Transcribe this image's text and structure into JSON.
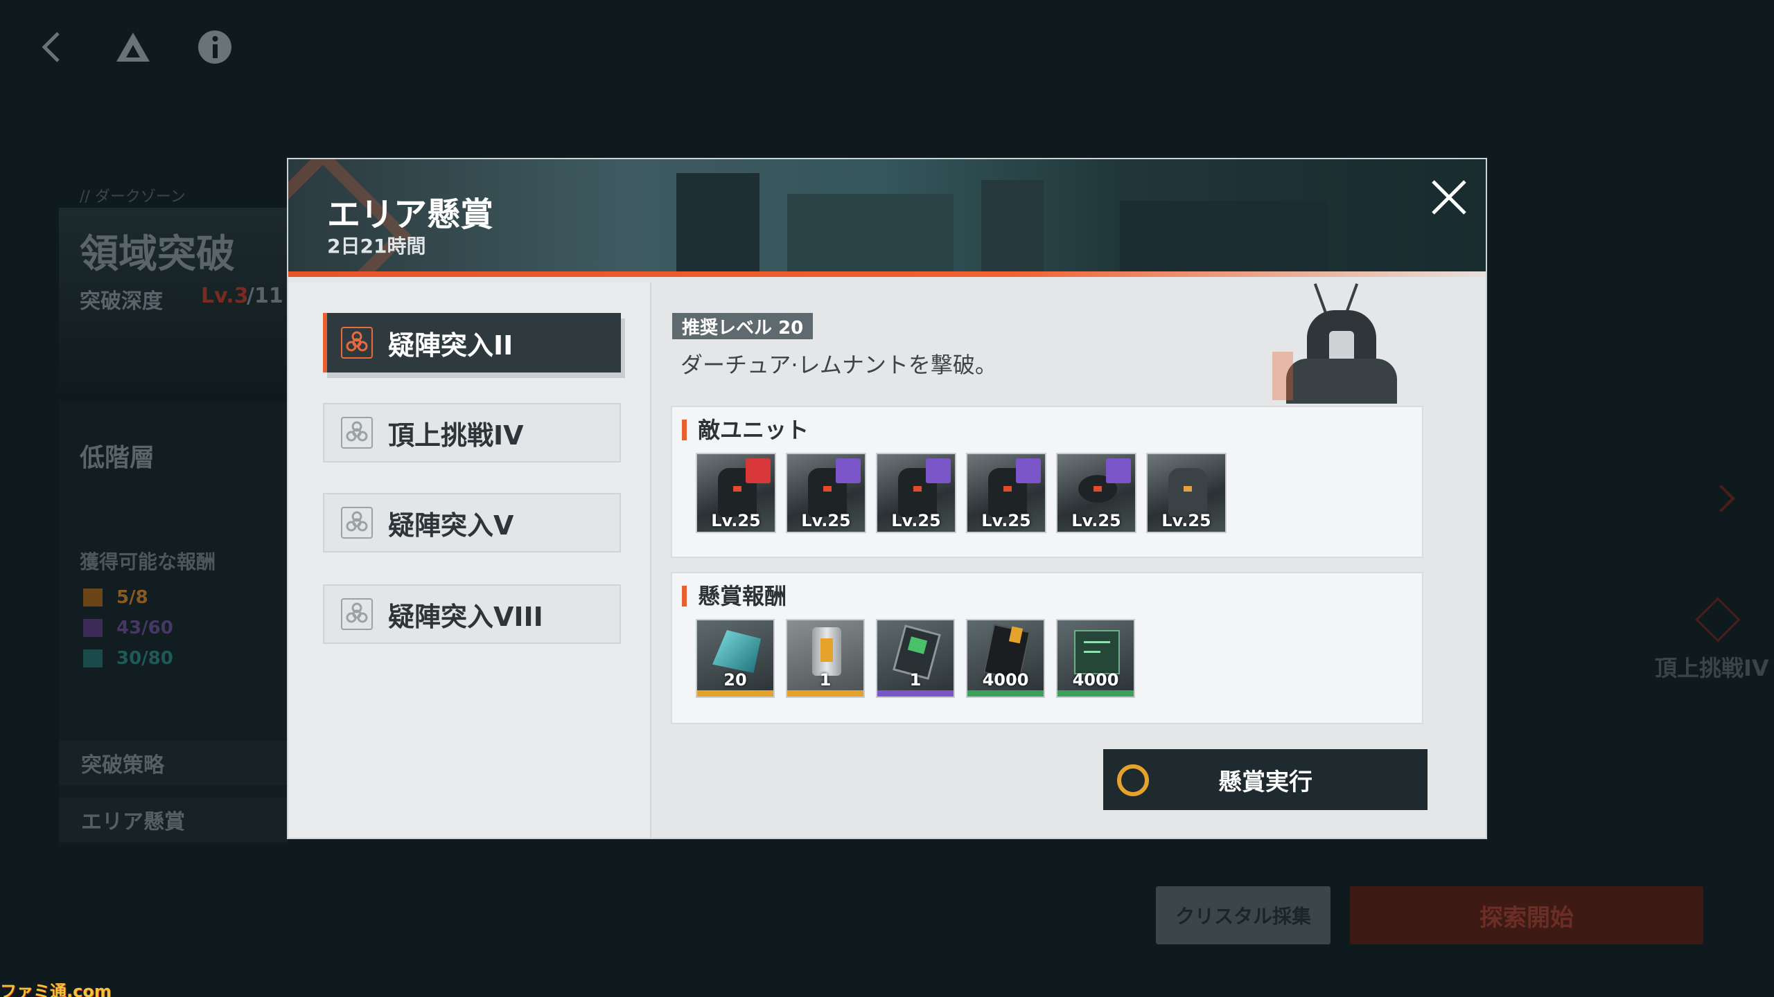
{
  "top_bar": {
    "icons": [
      "back-icon",
      "triangle-logo-icon",
      "info-icon"
    ]
  },
  "background_panel": {
    "zone_label": "// ダークゾーン",
    "title": "領域突破",
    "depth_label": "突破深度",
    "depth_value": "Lv.3",
    "depth_max": "/11",
    "floor_label": "低階層",
    "rewards_label": "獲得可能な報酬",
    "rewards": [
      {
        "value": "5/8",
        "color": "#b0681c"
      },
      {
        "value": "43/60",
        "color": "#5a3e80"
      },
      {
        "value": "30/80",
        "color": "#1f6b6a"
      }
    ],
    "strategy_button": "突破策略",
    "bounty_button": "エリア懸賞",
    "right_label": "頂上挑戦IV"
  },
  "bottom_buttons": {
    "crystal": "クリスタル採集",
    "explore": "探索開始"
  },
  "modal": {
    "title": "エリア懸賞",
    "time_remaining": "2日21時間",
    "tabs": [
      {
        "label": "疑陣突入II",
        "active": true
      },
      {
        "label": "頂上挑戦IV",
        "active": false
      },
      {
        "label": "疑陣突入V",
        "active": false
      },
      {
        "label": "疑陣突入VIII",
        "active": false
      }
    ],
    "recommended_level": "推奨レベル 20",
    "description": "ダーチュア·レムナントを撃破。",
    "enemy_section": {
      "title": "敵ユニット",
      "units": [
        {
          "level": "Lv.25",
          "badge_color": "#d9383a"
        },
        {
          "level": "Lv.25",
          "badge_color": "#7b56c8"
        },
        {
          "level": "Lv.25",
          "badge_color": "#7b56c8"
        },
        {
          "level": "Lv.25",
          "badge_color": "#7b56c8"
        },
        {
          "level": "Lv.25",
          "badge_color": "#7b56c8"
        },
        {
          "level": "Lv.25",
          "badge_color": ""
        }
      ]
    },
    "reward_section": {
      "title": "懸賞報酬",
      "items": [
        {
          "qty": "20",
          "rarity_color": "#e6a32c",
          "icon": "crystal-icon"
        },
        {
          "qty": "1",
          "rarity_color": "#e6a32c",
          "icon": "battery-icon"
        },
        {
          "qty": "1",
          "rarity_color": "#7b56c8",
          "icon": "chip-icon"
        },
        {
          "qty": "4000",
          "rarity_color": "#3aa05a",
          "icon": "ammo-card-icon"
        },
        {
          "qty": "4000",
          "rarity_color": "#3aa05a",
          "icon": "data-card-icon"
        }
      ]
    },
    "execute_button": "懸賞実行"
  },
  "watermark": "ファミ通.com"
}
